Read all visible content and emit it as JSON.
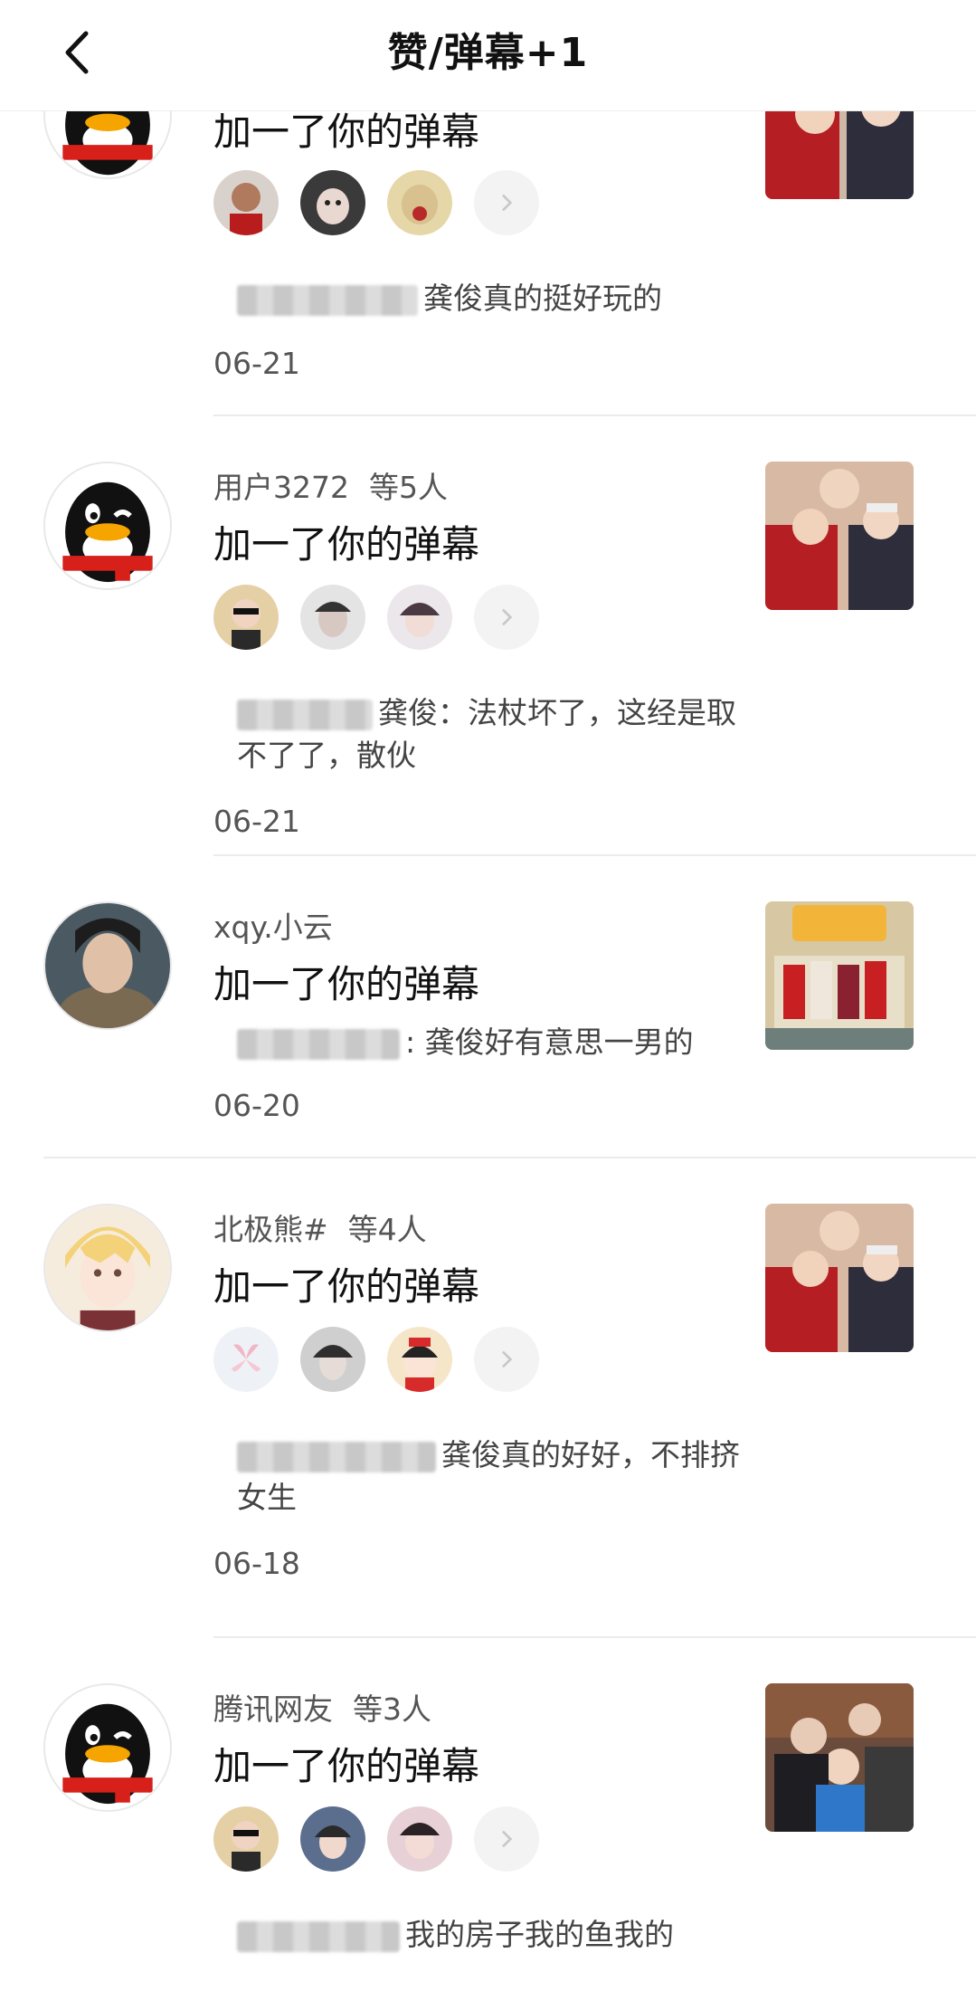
{
  "header": {
    "title": "赞/弹幕+1"
  },
  "items": [
    {
      "name": "",
      "count": "",
      "action": "加一了你的弹幕",
      "quote": "龚俊真的挺好玩的",
      "date": "06-21",
      "avatar": "qq-penguin-avatar",
      "thumb": "show-still-thumbnail"
    },
    {
      "name": "用户3272",
      "count": "等5人",
      "action": "加一了你的弹幕",
      "quote": "龚俊：法杖坏了，这经是取不了了，散伙",
      "date": "06-21",
      "avatar": "qq-penguin-avatar",
      "thumb": "show-still-thumbnail"
    },
    {
      "name": "xqy.小云",
      "count": "",
      "action": "加一了你的弹幕",
      "quote": ": 龚俊好有意思一男的",
      "date": "06-20",
      "avatar": "user-photo-avatar",
      "thumb": "show-poster-thumbnail"
    },
    {
      "name": "北极熊#",
      "count": "等4人",
      "action": "加一了你的弹幕",
      "quote": "龚俊真的好好，不排挤女生",
      "date": "06-18",
      "avatar": "anime-avatar",
      "thumb": "show-still-thumbnail"
    },
    {
      "name": "腾讯网友",
      "count": "等3人",
      "action": "加一了你的弹幕",
      "quote": "我的房子我的鱼我的",
      "date": "",
      "avatar": "qq-penguin-avatar",
      "thumb": "show-group-thumbnail"
    }
  ]
}
